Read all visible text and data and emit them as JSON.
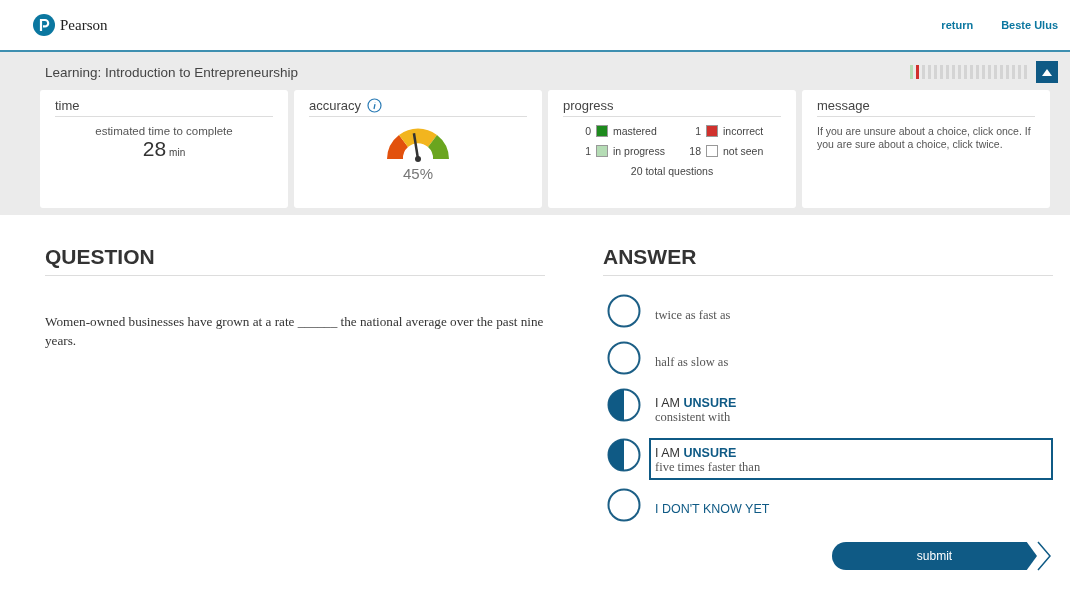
{
  "header": {
    "brand": "Pearson",
    "links": [
      {
        "label": "return"
      },
      {
        "label": "Beste Ulus"
      }
    ]
  },
  "course": {
    "title": "Learning: Introduction to Entrepreneurship",
    "segments": [
      {
        "kind": "in_progress"
      },
      {
        "kind": "incorrect"
      },
      {
        "kind": "not_seen"
      },
      {
        "kind": "not_seen"
      },
      {
        "kind": "not_seen"
      },
      {
        "kind": "not_seen"
      },
      {
        "kind": "not_seen"
      },
      {
        "kind": "not_seen"
      },
      {
        "kind": "not_seen"
      },
      {
        "kind": "not_seen"
      },
      {
        "kind": "not_seen"
      },
      {
        "kind": "not_seen"
      },
      {
        "kind": "not_seen"
      },
      {
        "kind": "not_seen"
      },
      {
        "kind": "not_seen"
      },
      {
        "kind": "not_seen"
      },
      {
        "kind": "not_seen"
      },
      {
        "kind": "not_seen"
      },
      {
        "kind": "not_seen"
      },
      {
        "kind": "not_seen"
      }
    ],
    "collapsed": false
  },
  "time": {
    "title": "time",
    "caption": "estimated time to complete",
    "value": "28",
    "unit": "min"
  },
  "accuracy": {
    "title": "accuracy",
    "level": 0.45,
    "reading": "45%"
  },
  "progress": {
    "title": "progress",
    "items": [
      {
        "count": "0",
        "label": "mastered",
        "color": "#1e8a1e"
      },
      {
        "count": "1",
        "label": "incorrect",
        "color": "#d0312d"
      },
      {
        "count": "1",
        "label": "in progress",
        "color": "#b5dcb5"
      },
      {
        "count": "18",
        "label": "not seen",
        "color": "#ffffff"
      }
    ],
    "total": "20 total questions"
  },
  "message": {
    "title": "message",
    "text": "If you are unsure about a choice, click once. If you are sure about a choice, click twice."
  },
  "question": {
    "heading": "QUESTION",
    "text": "Women-owned businesses have grown at a rate ______ the national average over the past nine years."
  },
  "answer": {
    "heading": "ANSWER",
    "options": [
      {
        "kind": "choice",
        "unsure": false,
        "text": "twice as fast as",
        "selected": false
      },
      {
        "kind": "choice",
        "unsure": false,
        "text": "half as slow as",
        "selected": false
      },
      {
        "kind": "choice",
        "unsure": true,
        "status": "I AM **UNSURE**",
        "text": "consistent with",
        "selected": false
      },
      {
        "kind": "choice",
        "unsure": true,
        "status": "I AM **UNSURE**",
        "text": "five times faster than",
        "selected": true
      },
      {
        "kind": "dont_know",
        "unsure": false,
        "text": "I DON'T KNOW YET",
        "selected": false
      }
    ]
  },
  "submit": {
    "label": "submit"
  }
}
